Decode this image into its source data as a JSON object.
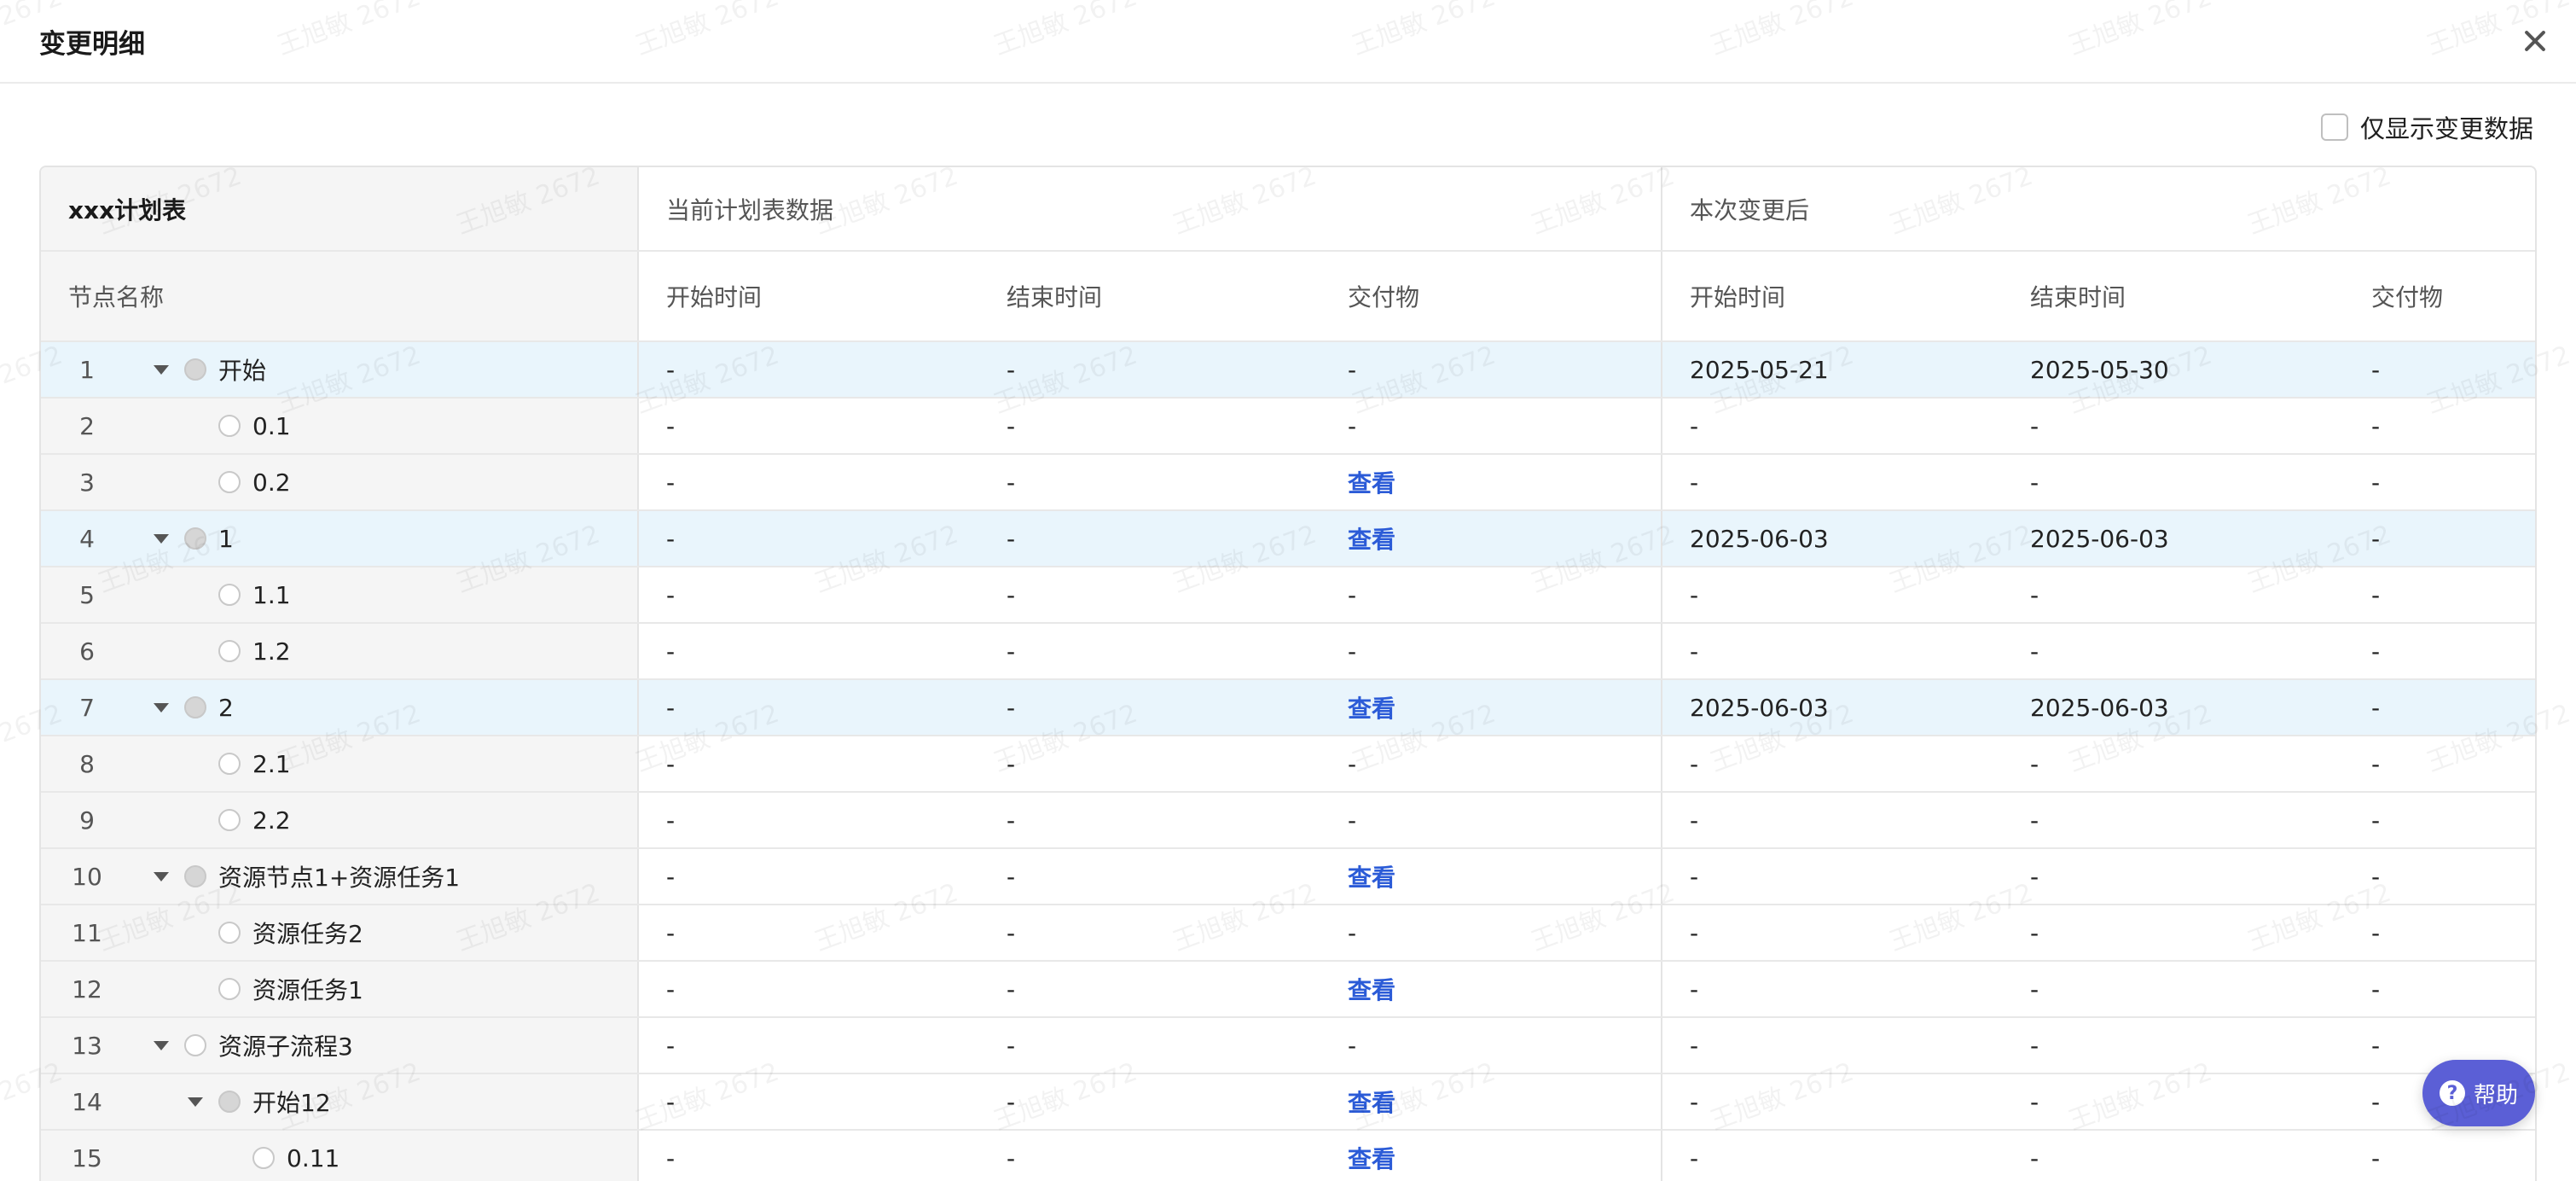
{
  "dialog": {
    "title": "变更明细"
  },
  "filter": {
    "label": "仅显示变更数据"
  },
  "table": {
    "group_headers": [
      "xxx计划表",
      "当前计划表数据",
      "本次变更后"
    ],
    "columns": [
      "节点名称",
      "开始时间",
      "结束时间",
      "交付物",
      "开始时间",
      "结束时间",
      "交付物"
    ],
    "rows": [
      {
        "index": "1",
        "name": "开始",
        "level": 0,
        "expandable": true,
        "filled": true,
        "highlight": true,
        "cur_start": "-",
        "cur_end": "-",
        "cur_deliv": "-",
        "new_start": "2025-05-21",
        "new_end": "2025-05-30",
        "new_deliv": "-"
      },
      {
        "index": "2",
        "name": "0.1",
        "level": 1,
        "expandable": false,
        "filled": false,
        "highlight": false,
        "cur_start": "-",
        "cur_end": "-",
        "cur_deliv": "-",
        "new_start": "-",
        "new_end": "-",
        "new_deliv": "-"
      },
      {
        "index": "3",
        "name": "0.2",
        "level": 1,
        "expandable": false,
        "filled": false,
        "highlight": false,
        "cur_start": "-",
        "cur_end": "-",
        "cur_deliv": "查看",
        "new_start": "-",
        "new_end": "-",
        "new_deliv": "-"
      },
      {
        "index": "4",
        "name": "1",
        "level": 0,
        "expandable": true,
        "filled": true,
        "highlight": true,
        "cur_start": "-",
        "cur_end": "-",
        "cur_deliv": "查看",
        "new_start": "2025-06-03",
        "new_end": "2025-06-03",
        "new_deliv": "-"
      },
      {
        "index": "5",
        "name": "1.1",
        "level": 1,
        "expandable": false,
        "filled": false,
        "highlight": false,
        "cur_start": "-",
        "cur_end": "-",
        "cur_deliv": "-",
        "new_start": "-",
        "new_end": "-",
        "new_deliv": "-"
      },
      {
        "index": "6",
        "name": "1.2",
        "level": 1,
        "expandable": false,
        "filled": false,
        "highlight": false,
        "cur_start": "-",
        "cur_end": "-",
        "cur_deliv": "-",
        "new_start": "-",
        "new_end": "-",
        "new_deliv": "-"
      },
      {
        "index": "7",
        "name": "2",
        "level": 0,
        "expandable": true,
        "filled": true,
        "highlight": true,
        "cur_start": "-",
        "cur_end": "-",
        "cur_deliv": "查看",
        "new_start": "2025-06-03",
        "new_end": "2025-06-03",
        "new_deliv": "-"
      },
      {
        "index": "8",
        "name": "2.1",
        "level": 1,
        "expandable": false,
        "filled": false,
        "highlight": false,
        "cur_start": "-",
        "cur_end": "-",
        "cur_deliv": "-",
        "new_start": "-",
        "new_end": "-",
        "new_deliv": "-"
      },
      {
        "index": "9",
        "name": "2.2",
        "level": 1,
        "expandable": false,
        "filled": false,
        "highlight": false,
        "cur_start": "-",
        "cur_end": "-",
        "cur_deliv": "-",
        "new_start": "-",
        "new_end": "-",
        "new_deliv": "-"
      },
      {
        "index": "10",
        "name": "资源节点1+资源任务1",
        "level": 0,
        "expandable": true,
        "filled": true,
        "highlight": false,
        "cur_start": "-",
        "cur_end": "-",
        "cur_deliv": "查看",
        "new_start": "-",
        "new_end": "-",
        "new_deliv": "-"
      },
      {
        "index": "11",
        "name": "资源任务2",
        "level": 1,
        "expandable": false,
        "filled": false,
        "highlight": false,
        "cur_start": "-",
        "cur_end": "-",
        "cur_deliv": "-",
        "new_start": "-",
        "new_end": "-",
        "new_deliv": "-"
      },
      {
        "index": "12",
        "name": "资源任务1",
        "level": 1,
        "expandable": false,
        "filled": false,
        "highlight": false,
        "cur_start": "-",
        "cur_end": "-",
        "cur_deliv": "查看",
        "new_start": "-",
        "new_end": "-",
        "new_deliv": "-"
      },
      {
        "index": "13",
        "name": "资源子流程3",
        "level": 0,
        "expandable": true,
        "filled": false,
        "highlight": false,
        "cur_start": "-",
        "cur_end": "-",
        "cur_deliv": "-",
        "new_start": "-",
        "new_end": "-",
        "new_deliv": "-"
      },
      {
        "index": "14",
        "name": "开始12",
        "level": 1,
        "expandable": true,
        "filled": true,
        "highlight": false,
        "cur_start": "-",
        "cur_end": "-",
        "cur_deliv": "查看",
        "new_start": "-",
        "new_end": "-",
        "new_deliv": "-"
      },
      {
        "index": "15",
        "name": "0.11",
        "level": 2,
        "expandable": false,
        "filled": false,
        "highlight": false,
        "cur_start": "-",
        "cur_end": "-",
        "cur_deliv": "查看",
        "new_start": "-",
        "new_end": "-",
        "new_deliv": "-"
      }
    ]
  },
  "help": {
    "label": "帮助"
  },
  "watermark": {
    "text": "王旭敏 2672"
  },
  "colors": {
    "link": "#2b5bd7",
    "highlight_row": "#e9f5fc",
    "help_button": "#5b5fd6"
  }
}
